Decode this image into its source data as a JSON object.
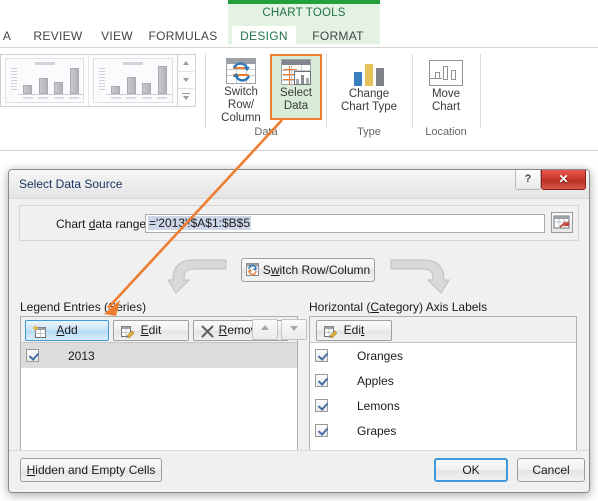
{
  "ribbon": {
    "contextual_tab_group": "CHART TOOLS",
    "tabs": [
      {
        "label": "A",
        "active": false
      },
      {
        "label": "REVIEW",
        "active": false
      },
      {
        "label": "VIEW",
        "active": false
      },
      {
        "label": "FORMULAS",
        "active": false
      },
      {
        "label": "DESIGN",
        "active": true
      },
      {
        "label": "FORMAT",
        "active": false
      }
    ],
    "groups": [
      {
        "label": "Data"
      },
      {
        "label": "Type"
      },
      {
        "label": "Location"
      }
    ],
    "buttons": {
      "switch_row_column_line1": "Switch Row/",
      "switch_row_column_line2": "Column",
      "select_data_line1": "Select",
      "select_data_line2": "Data",
      "change_chart_type_line1": "Change",
      "change_chart_type_line2": "Chart Type",
      "move_chart_line1": "Move",
      "move_chart_line2": "Chart"
    },
    "highlight_color": "#ed7d31",
    "accent_green": "#217346"
  },
  "dialog": {
    "title": "Select Data Source",
    "help_glyph": "?",
    "close_glyph": "✕",
    "range": {
      "label_pre": "Chart ",
      "label_key": "d",
      "label_post": "ata range:",
      "value": "='2013'!$A$1:$B$5",
      "picker_tooltip": "Collapse Dialog"
    },
    "switch_button": {
      "pre": "S",
      "key": "w",
      "post": "itch Row/Column"
    },
    "legend_panel": {
      "heading_pre": "Legend Entries (",
      "heading_key": "S",
      "heading_post": "eries)",
      "buttons": {
        "add_pre": "",
        "add_key": "A",
        "add_post": "dd",
        "edit_pre": "",
        "edit_key": "E",
        "edit_post": "dit",
        "remove_pre": "",
        "remove_key": "R",
        "remove_post": "emove",
        "move_up": "▲",
        "move_down": "▼"
      },
      "items": [
        {
          "label": "2013",
          "checked": true,
          "selected": true
        }
      ]
    },
    "category_panel": {
      "heading_pre": "Horizontal (",
      "heading_key": "C",
      "heading_post": "ategory) Axis Labels",
      "edit_button": {
        "pre": "Edi",
        "key": "t",
        "post": ""
      },
      "items": [
        {
          "label": "Oranges",
          "checked": true
        },
        {
          "label": "Apples",
          "checked": true
        },
        {
          "label": "Lemons",
          "checked": true
        },
        {
          "label": "Grapes",
          "checked": true
        }
      ]
    },
    "footer": {
      "hidden_cells_pre": "",
      "hidden_cells_key": "H",
      "hidden_cells_post": "idden and Empty Cells",
      "ok": "OK",
      "cancel": "Cancel"
    }
  }
}
